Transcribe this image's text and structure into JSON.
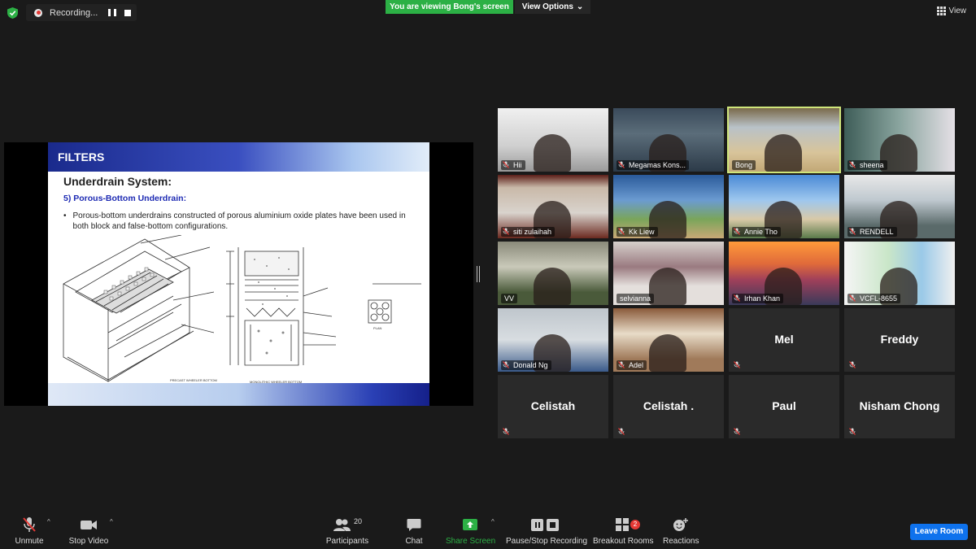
{
  "top": {
    "recording_label": "Recording...",
    "viewing_banner": "You are viewing Bong's screen",
    "view_options_label": "View Options",
    "view_label": "View"
  },
  "slide": {
    "header": "FILTERS",
    "title": "Underdrain System:",
    "subtitle": "5) Porous-Bottom Underdrain:",
    "bullet": "Porous-bottom underdrains constructed of porous aluminium oxide plates have been used in both block and false-bottom configurations.",
    "caption_left": "PRECAST WHEELER BOTTOM",
    "caption_right": "MONOLITHIC WHEELER BOTTOM",
    "caption_plan": "PLAN"
  },
  "participants": [
    {
      "name": "Hii",
      "muted": true,
      "video": true
    },
    {
      "name": "Megamas Kons...",
      "muted": true,
      "video": true
    },
    {
      "name": "Bong",
      "muted": false,
      "video": true,
      "active": true
    },
    {
      "name": "sheena",
      "muted": true,
      "video": true
    },
    {
      "name": "siti zulaihah",
      "muted": true,
      "video": true
    },
    {
      "name": "Kk Liew",
      "muted": true,
      "video": true
    },
    {
      "name": "Annie Tho",
      "muted": true,
      "video": true
    },
    {
      "name": "RENDELL",
      "muted": true,
      "video": true
    },
    {
      "name": "VV",
      "muted": false,
      "video": true
    },
    {
      "name": "selvianna",
      "muted": false,
      "video": true
    },
    {
      "name": "Irhan Khan",
      "muted": true,
      "video": true
    },
    {
      "name": "VCFL-8655",
      "muted": true,
      "video": true
    },
    {
      "name": "Donald Ng",
      "muted": true,
      "video": true
    },
    {
      "name": "Adel",
      "muted": true,
      "video": true
    },
    {
      "name": "Mel",
      "muted": true,
      "video": false
    },
    {
      "name": "Freddy",
      "muted": true,
      "video": false
    },
    {
      "name": "Celistah",
      "muted": true,
      "video": false
    },
    {
      "name": "Celistah .",
      "muted": true,
      "video": false
    },
    {
      "name": "Paul",
      "muted": true,
      "video": false
    },
    {
      "name": "Nisham Chong",
      "muted": true,
      "video": false
    }
  ],
  "toolbar": {
    "unmute": "Unmute",
    "stop_video": "Stop Video",
    "participants": "Participants",
    "participants_count": "20",
    "chat": "Chat",
    "share_screen": "Share Screen",
    "pause_stop_recording": "Pause/Stop Recording",
    "breakout_rooms": "Breakout Rooms",
    "breakout_badge": "2",
    "reactions": "Reactions",
    "leave_room": "Leave Room"
  },
  "colors": {
    "share_green": "#2cb045",
    "active_speaker": "#cfe57a",
    "leave_blue": "#0e72ed",
    "muted_red": "#e53935"
  }
}
